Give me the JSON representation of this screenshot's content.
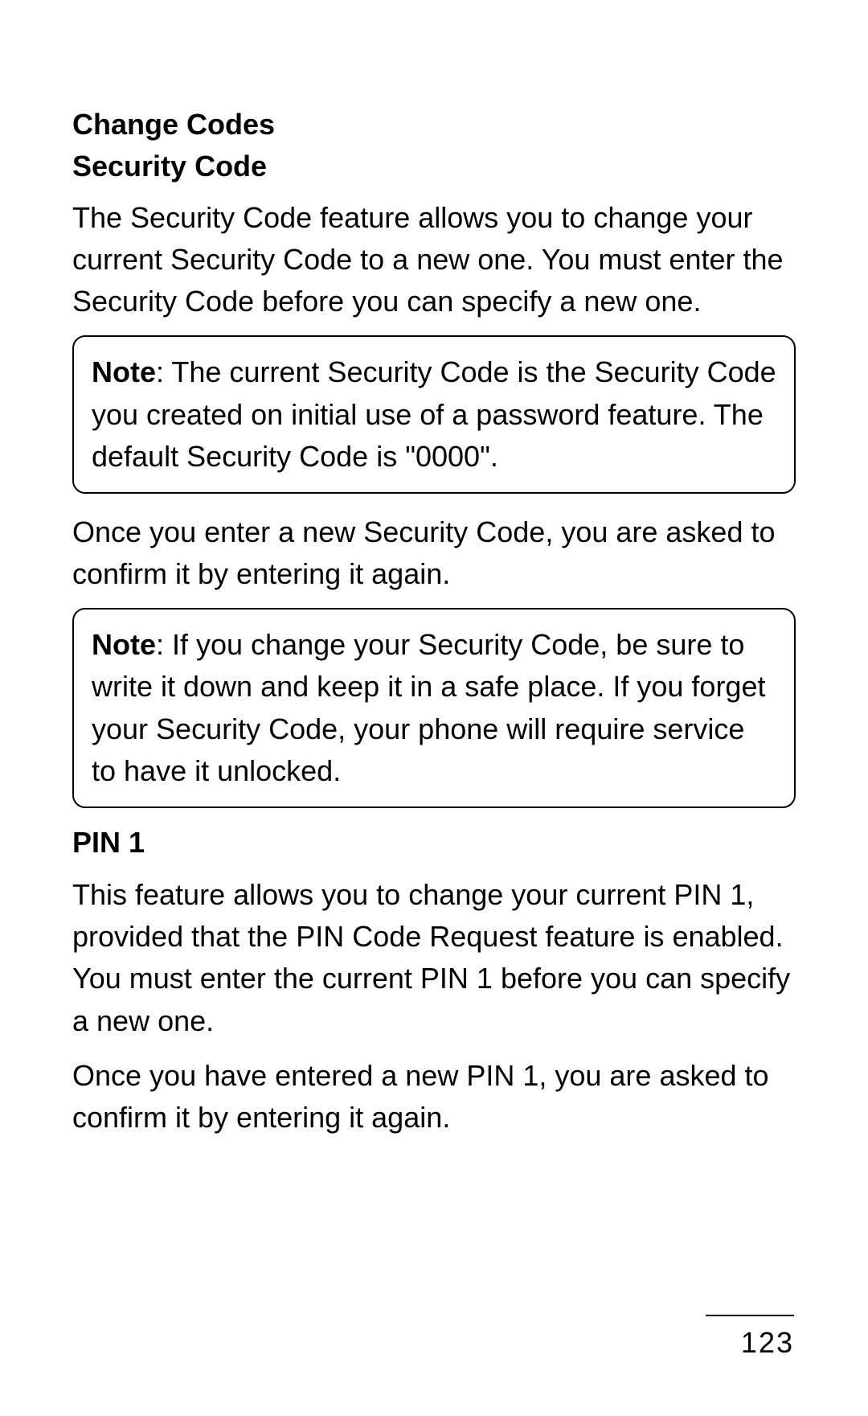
{
  "headings": {
    "change_codes": "Change Codes",
    "security_code": "Security Code",
    "pin1": "PIN 1"
  },
  "paragraphs": {
    "security_intro": "The Security Code feature allows you to change your current Security Code to a new one. You must enter the Security Code before you can specify a new one.",
    "security_confirm": "Once you enter a new Security Code, you are asked to confirm it by entering it again.",
    "pin1_intro": "This feature allows you to change your current PIN 1, provided that the PIN Code Request feature is enabled. You must enter the current PIN 1 before you can specify a new one.",
    "pin1_confirm": "Once you have entered a new PIN 1, you are asked to confirm it by entering it again."
  },
  "notes": {
    "label": "Note",
    "note1_text": ": The current Security Code is the Security Code you created on initial use of a password feature. The default Security Code is \"0000\".",
    "note2_text": ": If you change your Security Code, be sure to write it down and keep it in a safe place. If you forget your Security Code, your phone will require service to have it unlocked."
  },
  "page_number": "123"
}
